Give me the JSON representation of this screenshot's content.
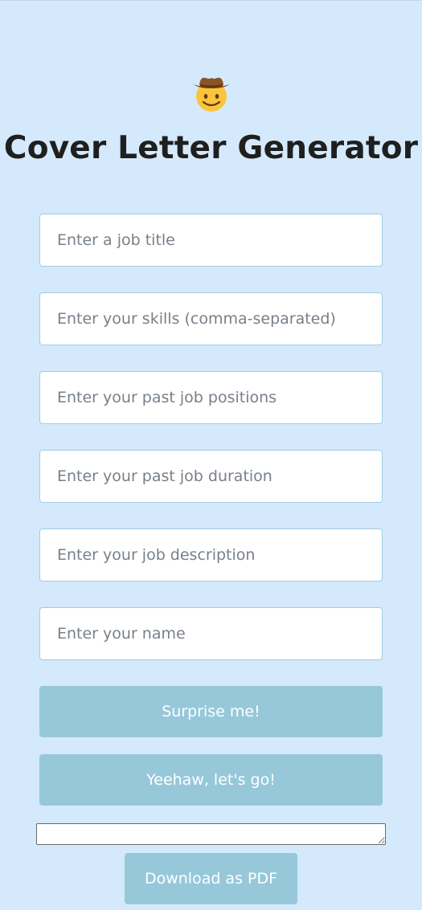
{
  "app": {
    "title": "Cover Letter Generator",
    "logo_icon": "cowboy-face-icon"
  },
  "form": {
    "job_title_placeholder": "Enter a job title",
    "skills_placeholder": "Enter your skills (comma-separated)",
    "past_positions_placeholder": "Enter your past job positions",
    "past_duration_placeholder": "Enter your past job duration",
    "job_description_placeholder": "Enter your job description",
    "name_placeholder": "Enter your name"
  },
  "actions": {
    "surprise_label": "Surprise me!",
    "generate_label": "Yeehaw, let's go!",
    "download_label": "Download as PDF"
  },
  "output": {
    "value": ""
  },
  "colors": {
    "background": "#d5e9fc",
    "button": "#96c8da",
    "input_border": "#9fcde0",
    "title_text": "#1f1f1f"
  }
}
